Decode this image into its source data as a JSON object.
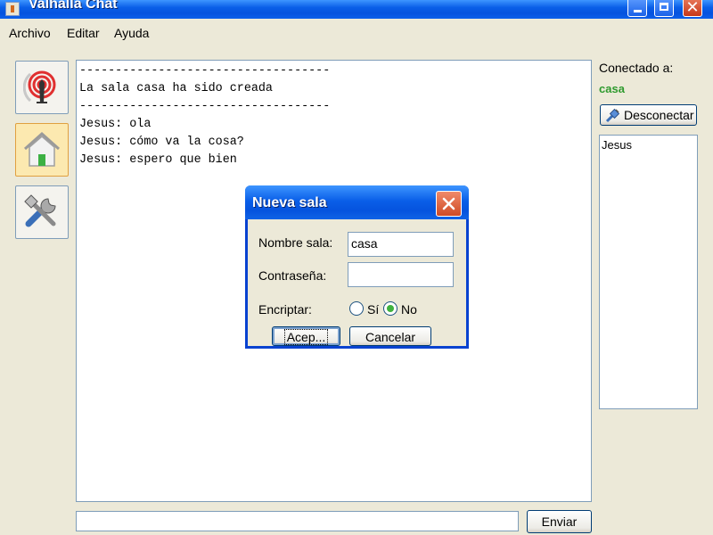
{
  "window": {
    "title": "Valhalla Chat"
  },
  "menu": {
    "archivo": "Archivo",
    "editar": "Editar",
    "ayuda": "Ayuda"
  },
  "chat": {
    "lines": [
      "-----------------------------------",
      "La sala casa ha sido creada",
      "-----------------------------------",
      "Jesus: ola",
      "Jesus: cómo va la cosa?",
      "Jesus: espero que bien"
    ]
  },
  "sidebar": {
    "buttons": [
      {
        "icon": "antenna-icon"
      },
      {
        "icon": "home-icon"
      },
      {
        "icon": "tools-icon"
      }
    ]
  },
  "right_panel": {
    "connected_label": "Conectado a:",
    "room": "casa",
    "disconnect_label": "Desconectar",
    "users": [
      "Jesus"
    ]
  },
  "bottom": {
    "message_value": "",
    "send_label": "Enviar"
  },
  "dialog": {
    "title": "Nueva sala",
    "nombre_label": "Nombre sala:",
    "nombre_value": "casa",
    "pass_label": "Contraseña:",
    "pass_value": "",
    "encrypt_label": "Encriptar:",
    "option_si": "Sí",
    "option_no": "No",
    "selected": "No",
    "accept_label": "Acep...",
    "cancel_label": "Cancelar"
  },
  "colors": {
    "titlebar": "#0A5FE8",
    "room_text": "#2E9A2E",
    "window_bg": "#ECE9D8"
  }
}
